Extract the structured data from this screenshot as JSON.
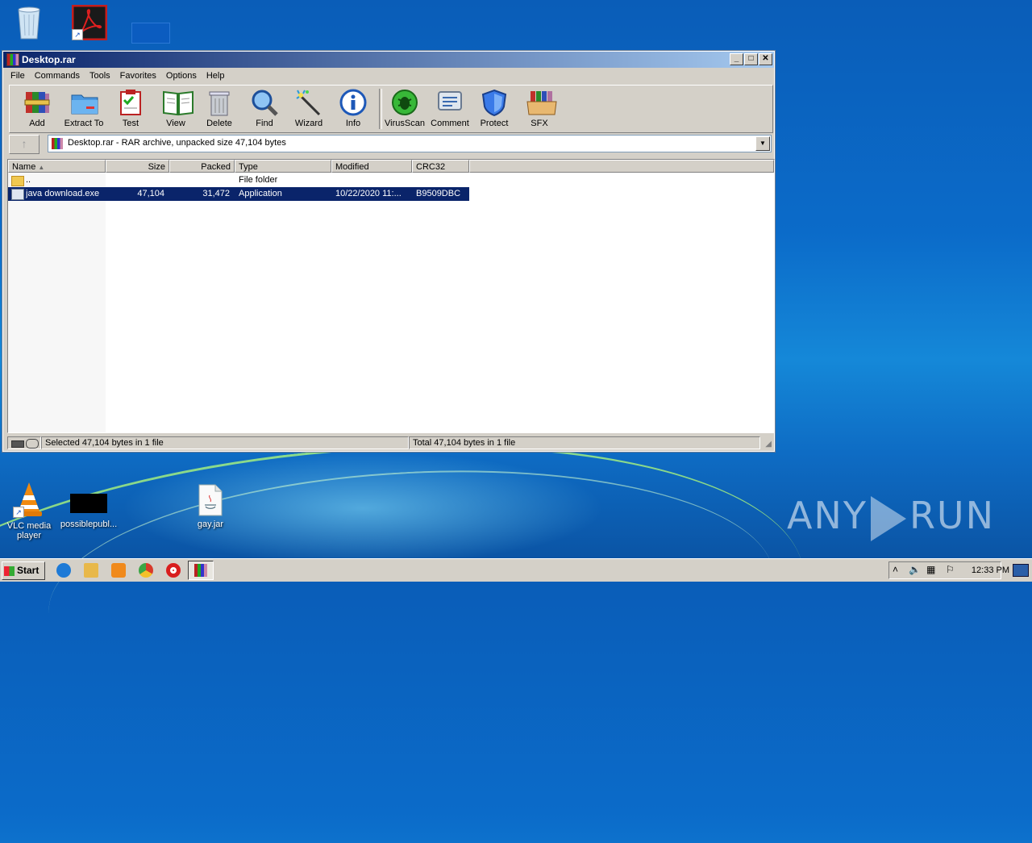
{
  "desktop": {
    "icons": [
      {
        "name": "recycle-bin",
        "label": ""
      },
      {
        "name": "adobe-reader",
        "label": ""
      },
      {
        "name": "vlc",
        "label": "VLC media player"
      },
      {
        "name": "possiblepub",
        "label": "possiblepubl..."
      },
      {
        "name": "gay-jar",
        "label": "gay.jar"
      }
    ],
    "watermark": {
      "left": "ANY",
      "right": "RUN"
    }
  },
  "window": {
    "title": "Desktop.rar",
    "controls": {
      "minimize": "_",
      "maximize": "□",
      "close": "✕"
    },
    "menu": [
      "File",
      "Commands",
      "Tools",
      "Favorites",
      "Options",
      "Help"
    ],
    "toolbar": [
      {
        "label": "Add",
        "icon": "add-archive-icon"
      },
      {
        "label": "Extract To",
        "icon": "extract-folder-icon"
      },
      {
        "label": "Test",
        "icon": "test-checklist-icon"
      },
      {
        "label": "View",
        "icon": "view-book-icon"
      },
      {
        "label": "Delete",
        "icon": "trash-can-icon"
      },
      {
        "label": "Find",
        "icon": "magnifier-icon"
      },
      {
        "label": "Wizard",
        "icon": "magic-wand-icon"
      },
      {
        "label": "Info",
        "icon": "info-icon"
      },
      {
        "label": "VirusScan",
        "icon": "bug-icon"
      },
      {
        "label": "Comment",
        "icon": "comment-icon"
      },
      {
        "label": "Protect",
        "icon": "shield-icon"
      },
      {
        "label": "SFX",
        "icon": "sfx-box-icon"
      }
    ],
    "address": "Desktop.rar - RAR archive, unpacked size 47,104 bytes",
    "columns": [
      "Name",
      "Size",
      "Packed",
      "Type",
      "Modified",
      "CRC32"
    ],
    "rows": [
      {
        "name": "..",
        "size": "",
        "packed": "",
        "type": "File folder",
        "modified": "",
        "crc": "",
        "selected": false
      },
      {
        "name": "java download.exe",
        "size": "47,104",
        "packed": "31,472",
        "type": "Application",
        "modified": "10/22/2020 11:...",
        "crc": "B9509DBC",
        "selected": true
      }
    ],
    "status_left": "Selected 47,104 bytes in 1 file",
    "status_right": "Total 47,104 bytes in 1 file"
  },
  "taskbar": {
    "start_label": "Start",
    "clock": "12:33 PM",
    "colors": {
      "ie": "#1e7ad6",
      "explorer": "#e8b84a",
      "media": "#f08a1c",
      "chrome": "#3aa645",
      "opera": "#d81e1e"
    }
  }
}
